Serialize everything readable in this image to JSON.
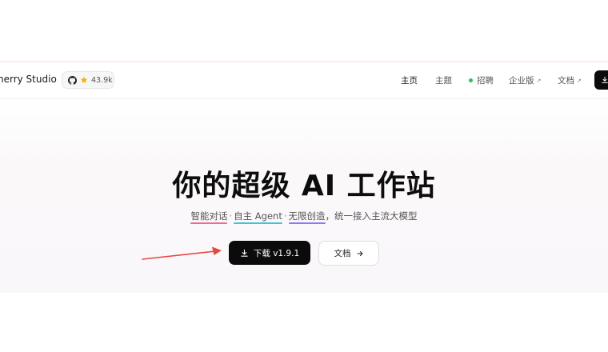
{
  "navbar": {
    "brand": "herry Studio",
    "github_stars": "43.9k",
    "items": [
      {
        "label": "主页",
        "active": true
      },
      {
        "label": "主题"
      },
      {
        "label": "招聘"
      },
      {
        "label": "企业版",
        "ext": "↗"
      },
      {
        "label": "文档",
        "ext": "↗"
      }
    ]
  },
  "hero": {
    "title": "你的超级 AI 工作站",
    "subtitle": {
      "part1": "智能对话",
      "sep": "·",
      "part2": "自主 Agent",
      "part3": "无限创造",
      "tail": "，统一接入主流大模型"
    },
    "download_label": "下载 v1.9.1",
    "docs_label": "文档"
  },
  "colors": {
    "accent_dark": "#0b0b0b",
    "underline_pink": "#ec6b9a",
    "underline_cyan": "#3ec3d8",
    "underline_purple": "#8b7cf0",
    "annotation_arrow": "#e8473f",
    "status_green": "#22c55e"
  },
  "icons": {
    "github": "github-icon",
    "star": "star-icon",
    "download": "download-icon",
    "arrow_right": "arrow-right-icon",
    "external": "external-link-icon"
  }
}
